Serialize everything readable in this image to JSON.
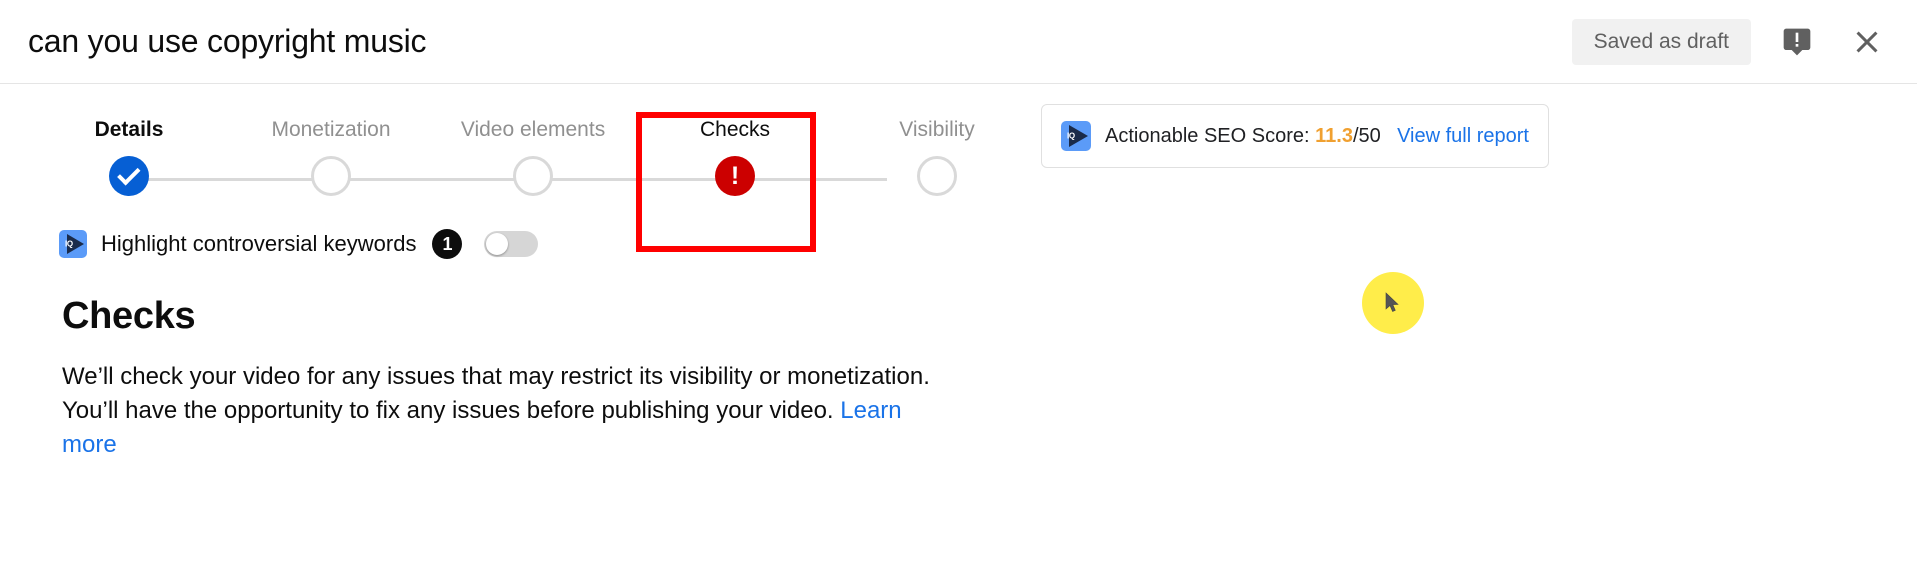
{
  "header": {
    "video_title": "can you use copyright music",
    "draft_status": "Saved as draft",
    "feedback_icon": "feedback-exclamation-icon",
    "close_icon": "close-icon"
  },
  "stepper": {
    "steps": [
      {
        "label": "Details",
        "state": "done",
        "node": "check"
      },
      {
        "label": "Monetization",
        "state": "empty",
        "node": ""
      },
      {
        "label": "Video elements",
        "state": "empty",
        "node": ""
      },
      {
        "label": "Checks",
        "state": "error",
        "node": "!"
      },
      {
        "label": "Visibility",
        "state": "empty",
        "node": ""
      }
    ],
    "highlighted_step": "Checks"
  },
  "seo_card": {
    "icon": "vidiq-logo-icon",
    "icon_text": "IQ",
    "label": "Actionable SEO Score:",
    "score": "11.3",
    "max": "/50",
    "link": "View full report",
    "accent_color": "#f0a030",
    "link_color": "#1a73e8"
  },
  "toggle_row": {
    "icon": "vidiq-logo-icon",
    "label": "Highlight controversial keywords",
    "badge": "1",
    "switch_state": "off"
  },
  "main": {
    "heading": "Checks",
    "description_part1": "We’ll check your video for any issues that may restrict its visibility or monetization. You’ll have the opportunity to fix any issues before publishing your video. ",
    "learn_more": "Learn more"
  },
  "colors": {
    "primary_blue": "#065fd4",
    "error_red": "#cc0000",
    "highlight_red": "#ff0000",
    "cursor_yellow": "#ffed4a"
  }
}
